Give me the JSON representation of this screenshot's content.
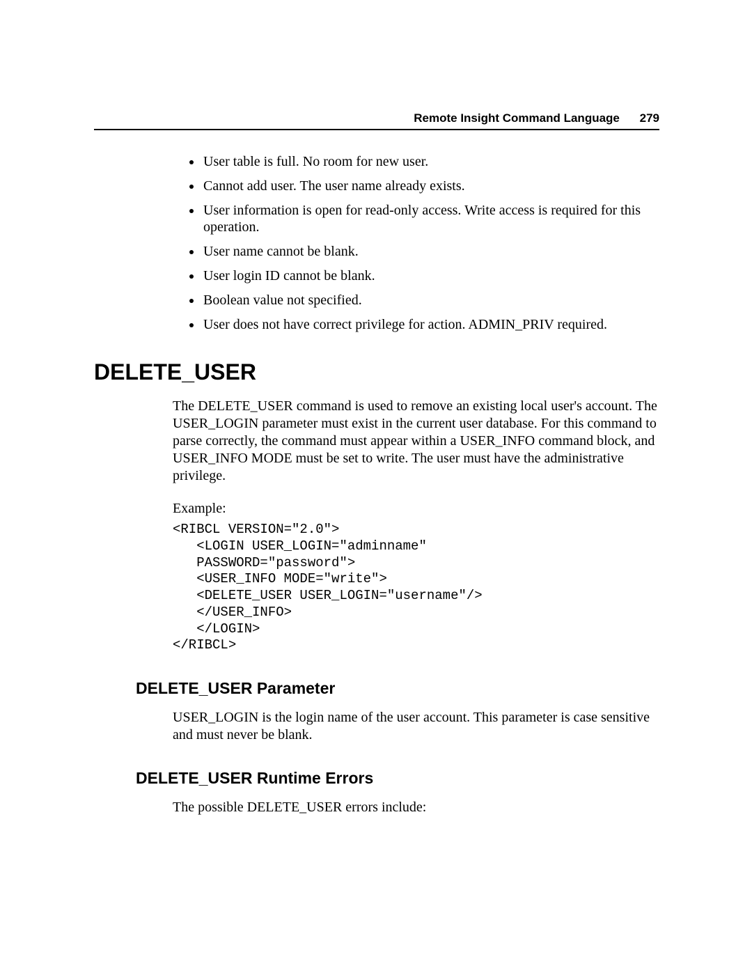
{
  "header": {
    "title": "Remote Insight Command Language",
    "page_num": "279"
  },
  "errors": {
    "items": [
      "User table is full. No room for new user.",
      "Cannot add user. The user name already exists.",
      "User information is open for read-only access. Write access is required for this operation.",
      "User name cannot be blank.",
      "User login ID cannot be blank.",
      "Boolean value not specified.",
      "User does not have correct privilege for action. ADMIN_PRIV required."
    ]
  },
  "section": {
    "title": "DELETE_USER",
    "desc": "The DELETE_USER command is used to remove an existing local user's account. The USER_LOGIN parameter must exist in the current user database. For this command to parse correctly, the command must appear within a USER_INFO command block, and USER_INFO MODE must be set to write. The user must have the administrative privilege.",
    "example_label": "Example:",
    "code": "<RIBCL VERSION=\"2.0\">\n   <LOGIN USER_LOGIN=\"adminname\"\n   PASSWORD=\"password\">\n   <USER_INFO MODE=\"write\">\n   <DELETE_USER USER_LOGIN=\"username\"/>\n   </USER_INFO>\n   </LOGIN>\n</RIBCL>"
  },
  "param": {
    "title": "DELETE_USER Parameter",
    "desc": "USER_LOGIN is the login name of the user account. This parameter is case sensitive and must never be blank."
  },
  "runtime": {
    "title": "DELETE_USER Runtime Errors",
    "desc": "The possible DELETE_USER errors include:"
  }
}
